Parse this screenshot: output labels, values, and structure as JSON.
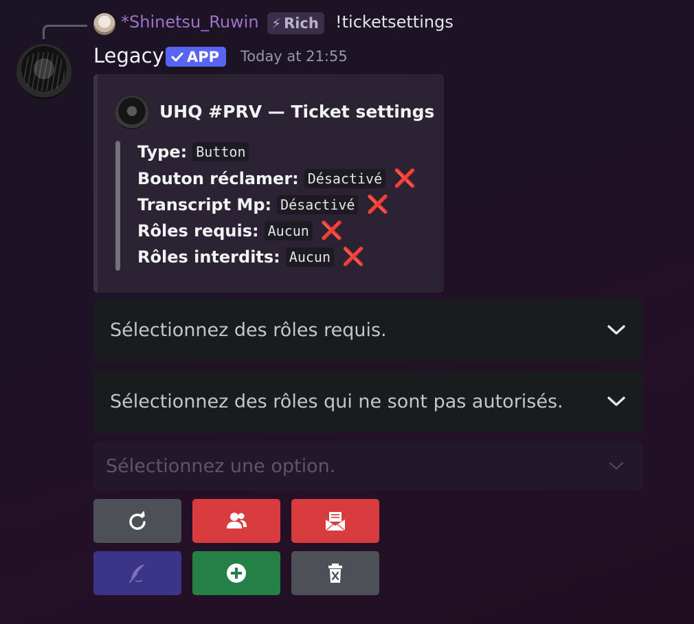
{
  "reply": {
    "author": "*Shinetsu_Ruwin",
    "badge": "Rich",
    "badge_icon": "lightning-icon",
    "content": "!ticketsettings"
  },
  "message": {
    "author": "Legacy",
    "app_badge": "APP",
    "timestamp": "Today at 21:55"
  },
  "embed": {
    "title": "UHQ #PRV — Ticket settings",
    "fields": [
      {
        "label": "Type:",
        "value": "Button",
        "status_icon": ""
      },
      {
        "label": "Bouton réclamer:",
        "value": "Désactivé",
        "status_icon": "❌"
      },
      {
        "label": "Transcript Mp:",
        "value": "Désactivé",
        "status_icon": "❌"
      },
      {
        "label": "Rôles requis:",
        "value": "Aucun",
        "status_icon": "❌"
      },
      {
        "label": "Rôles interdits:",
        "value": "Aucun",
        "status_icon": "❌"
      }
    ]
  },
  "selects": [
    {
      "placeholder": "Sélectionnez des rôles requis.",
      "disabled": false
    },
    {
      "placeholder": "Sélectionnez des rôles qui ne sont pas autorisés.",
      "disabled": false
    },
    {
      "placeholder": "Sélectionnez une option.",
      "disabled": true
    }
  ],
  "buttons": [
    {
      "icon": "refresh-icon",
      "color": "#4e5058"
    },
    {
      "icon": "users-icon",
      "color": "#d83c3e"
    },
    {
      "icon": "envelope-icon",
      "color": "#d83c3e"
    },
    {
      "icon": "feather-icon",
      "color": "#3c3489"
    },
    {
      "icon": "plus-circle-icon",
      "color": "#248046"
    },
    {
      "icon": "trash-icon",
      "color": "#4e5058"
    }
  ],
  "colors": {
    "app_badge": "#5865f2",
    "reply_author": "#a071c8",
    "error_x": "#dd2e44"
  }
}
